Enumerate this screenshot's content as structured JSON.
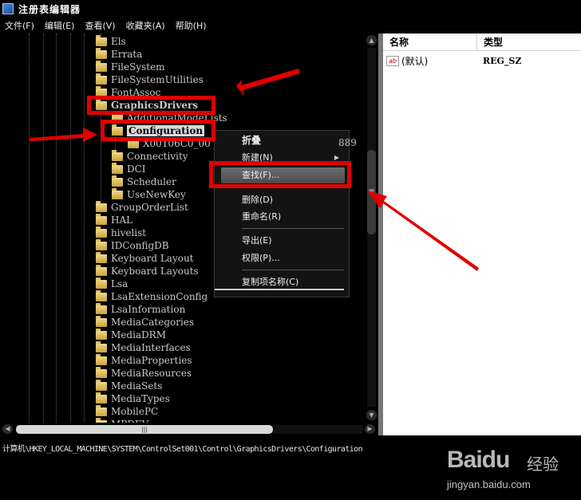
{
  "window": {
    "title": "注册表编辑器"
  },
  "menubar": {
    "items": [
      "文件(F)",
      "编辑(E)",
      "查看(V)",
      "收藏夹(A)",
      "帮助(H)"
    ]
  },
  "tree": {
    "nodes": [
      {
        "label": "Els",
        "depth": 1
      },
      {
        "label": "Errata",
        "depth": 1
      },
      {
        "label": "FileSystem",
        "depth": 1
      },
      {
        "label": "FileSystemUtilities",
        "depth": 1
      },
      {
        "label": "FontAssoc",
        "depth": 1
      },
      {
        "label": "GraphicsDrivers",
        "depth": 1,
        "expanded": true
      },
      {
        "label": "AdditionalModeLists",
        "depth": 2
      },
      {
        "label": "Configuration",
        "depth": 2,
        "selected": true
      },
      {
        "label": "X00106C0_00",
        "depth": 3
      },
      {
        "label": "Connectivity",
        "depth": 2
      },
      {
        "label": "DCI",
        "depth": 2
      },
      {
        "label": "Scheduler",
        "depth": 2
      },
      {
        "label": "UseNewKey",
        "depth": 2
      },
      {
        "label": "GroupOrderList",
        "depth": 1
      },
      {
        "label": "HAL",
        "depth": 1
      },
      {
        "label": "hivelist",
        "depth": 1
      },
      {
        "label": "IDConfigDB",
        "depth": 1
      },
      {
        "label": "Keyboard Layout",
        "depth": 1
      },
      {
        "label": "Keyboard Layouts",
        "depth": 1
      },
      {
        "label": "Lsa",
        "depth": 1
      },
      {
        "label": "LsaExtensionConfig",
        "depth": 1
      },
      {
        "label": "LsaInformation",
        "depth": 1
      },
      {
        "label": "MediaCategories",
        "depth": 1
      },
      {
        "label": "MediaDRM",
        "depth": 1
      },
      {
        "label": "MediaInterfaces",
        "depth": 1
      },
      {
        "label": "MediaProperties",
        "depth": 1
      },
      {
        "label": "MediaResources",
        "depth": 1
      },
      {
        "label": "MediaSets",
        "depth": 1
      },
      {
        "label": "MediaTypes",
        "depth": 1
      },
      {
        "label": "MobilePC",
        "depth": 1
      },
      {
        "label": "MPDEV",
        "depth": 1
      }
    ]
  },
  "list": {
    "columns": {
      "name": "名称",
      "type": "类型"
    },
    "rows": [
      {
        "icon": "string-value-icon",
        "icon_text": "ab",
        "name": "(默认)",
        "type": "REG_SZ"
      }
    ]
  },
  "context_menu": {
    "items": [
      {
        "label": "折叠",
        "bold": true
      },
      {
        "label": "新建(N)",
        "submenu": true
      },
      {
        "label": "查找(F)...",
        "hover": true
      },
      {
        "label": "删除(D)"
      },
      {
        "label": "重命名(R)"
      },
      {
        "label": "导出(E)"
      },
      {
        "label": "权限(P)..."
      },
      {
        "label": "复制项名称(C)"
      }
    ],
    "overflow_text": "889"
  },
  "statusbar": {
    "path": "计算机\\HKEY_LOCAL_MACHINE\\SYSTEM\\ControlSet001\\Control\\GraphicsDrivers\\Configuration"
  },
  "watermark": {
    "brand": "Baidu",
    "brand_cn": "经验",
    "url": "jingyan.baidu.com"
  },
  "annotation_color": "#e00000"
}
